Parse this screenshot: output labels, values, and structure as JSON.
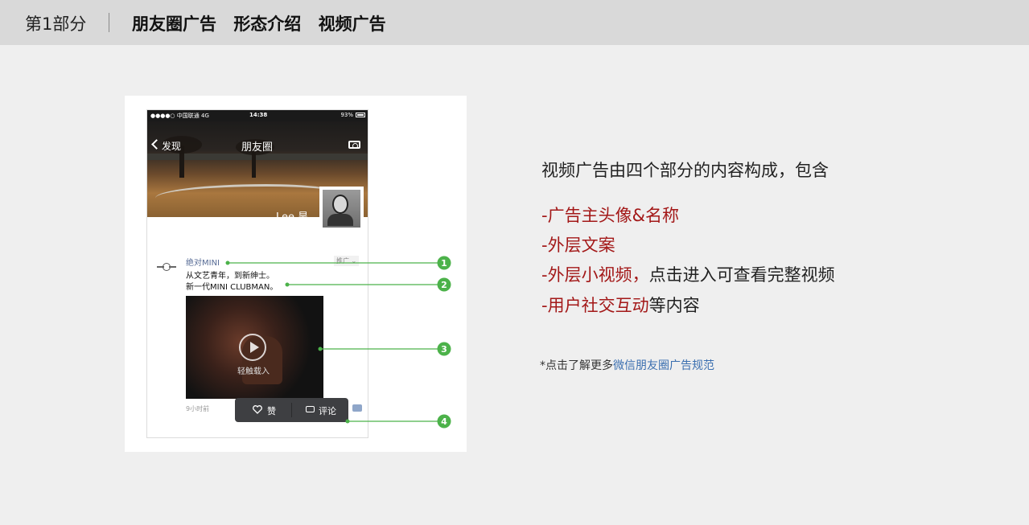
{
  "header": {
    "section": "第1部分",
    "crumbs": [
      "朋友圈广告",
      "形态介绍",
      "视频广告"
    ]
  },
  "phone": {
    "status": {
      "carrier": "●●●●○ 中国联通  4G",
      "time": "14:38",
      "battery": "93%"
    },
    "nav": {
      "back_label": "发现",
      "title": "朋友圈"
    },
    "profile_name": "Lee 昊",
    "ad": {
      "name": "绝对MINI",
      "tag": "推广 ⌄",
      "copy_line1": "从文艺青年，到新绅士。",
      "copy_line2": "新一代MINI CLUBMAN。",
      "video_label": "轻触载入",
      "time_ago": "9小时前",
      "like_label": "赞",
      "comment_label": "评论"
    },
    "callouts": [
      "1",
      "2",
      "3",
      "4"
    ],
    "accent_color": "#4cb24a"
  },
  "description": {
    "intro": "视频广告由四个部分的内容构成，包含",
    "items": [
      {
        "red": "-广告主头像&名称",
        "black": ""
      },
      {
        "red": "-外层文案",
        "black": ""
      },
      {
        "red": "-外层小视频，",
        "black": "点击进入可查看完整视频"
      },
      {
        "red": "-用户社交互动",
        "black": "等内容"
      }
    ],
    "footnote_prefix": "*点击了解更多",
    "footnote_link": "微信朋友圈广告规范"
  }
}
